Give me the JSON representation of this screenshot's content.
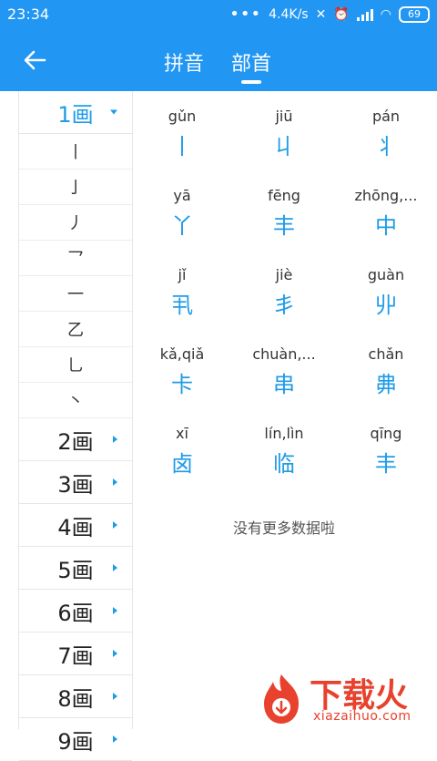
{
  "status": {
    "time": "23:34",
    "speed": "4.4K/s",
    "battery": "69"
  },
  "tabs": {
    "pinyin": "拼音",
    "bushou": "部首",
    "active": "部首"
  },
  "sidebar": {
    "active_group": "1画",
    "active_sub": [
      "丨",
      "亅",
      "丿",
      "乛",
      "一",
      "乙",
      "乚",
      "丶"
    ],
    "groups": [
      "2画",
      "3画",
      "4画",
      "5画",
      "6画",
      "7画",
      "8画",
      "9画"
    ]
  },
  "grid": [
    [
      {
        "py": "gǔn",
        "ch": "丨"
      },
      {
        "py": "jiū",
        "ch": "丩"
      },
      {
        "py": "pán",
        "ch": "丬"
      }
    ],
    [
      {
        "py": "yā",
        "ch": "丫"
      },
      {
        "py": "fēng",
        "ch": "丰"
      },
      {
        "py": "zhōng,...",
        "ch": "中"
      }
    ],
    [
      {
        "py": "jǐ",
        "ch": "丮"
      },
      {
        "py": "jiè",
        "ch": "丯"
      },
      {
        "py": "guàn",
        "ch": "丱"
      }
    ],
    [
      {
        "py": "kǎ,qiǎ",
        "ch": "卡"
      },
      {
        "py": "chuàn,...",
        "ch": "串"
      },
      {
        "py": "chǎn",
        "ch": "丳"
      }
    ],
    [
      {
        "py": "xī",
        "ch": "卤"
      },
      {
        "py": "lín,lìn",
        "ch": "临"
      },
      {
        "py": "qīng",
        "ch": "丰"
      }
    ]
  ],
  "footer": {
    "no_more": "没有更多数据啦"
  },
  "watermark": {
    "title": "下载火",
    "url": "xiazaihuo.com"
  },
  "colors": {
    "primary": "#2196F3",
    "accent": "#1E9BE8"
  }
}
